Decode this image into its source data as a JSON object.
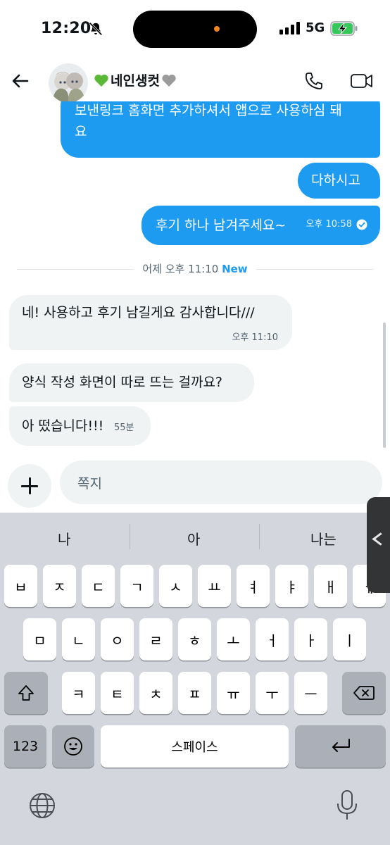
{
  "status_bar": {
    "time": "12:20",
    "network": "5G"
  },
  "header": {
    "contact_name": "네인생컷"
  },
  "messages": {
    "out_1": {
      "line1": "보낸링크 홈화면 추가하셔서 앱으로 사용하심 돼",
      "line2": "요"
    },
    "out_2": {
      "text": "다하시고"
    },
    "out_3": {
      "text": "후기 하나 남겨주세요~",
      "time": "오후 10:58"
    },
    "divider": {
      "label": "어제 오후 11:10",
      "new_badge": "New"
    },
    "in_1": {
      "text": "네! 사용하고 후기 남길게요 감사합니다///",
      "time": "오후 11:10"
    },
    "in_2": {
      "text": "양식 작성 화면이 따로 뜨는 걸까요?"
    },
    "in_3": {
      "text": "아 떴습니다!!!",
      "time": "55분"
    }
  },
  "compose": {
    "placeholder": "쪽지"
  },
  "keyboard": {
    "predictions": [
      "나",
      "아",
      "나는"
    ],
    "row1": [
      "ㅂ",
      "ㅈ",
      "ㄷ",
      "ㄱ",
      "ㅅ",
      "ㅛ",
      "ㅕ",
      "ㅑ",
      "ㅐ",
      "ㅔ"
    ],
    "row2": [
      "ㅁ",
      "ㄴ",
      "ㅇ",
      "ㄹ",
      "ㅎ",
      "ㅗ",
      "ㅓ",
      "ㅏ",
      "ㅣ"
    ],
    "row3": [
      "ㅋ",
      "ㅌ",
      "ㅊ",
      "ㅍ",
      "ㅠ",
      "ㅜ",
      "ㅡ"
    ],
    "numbers_key": "123",
    "space_key": "스페이스"
  },
  "colors": {
    "accent": "#1d9bf0",
    "bubble_in": "#eff3f4",
    "keyboard_bg": "#d3d6dc"
  }
}
